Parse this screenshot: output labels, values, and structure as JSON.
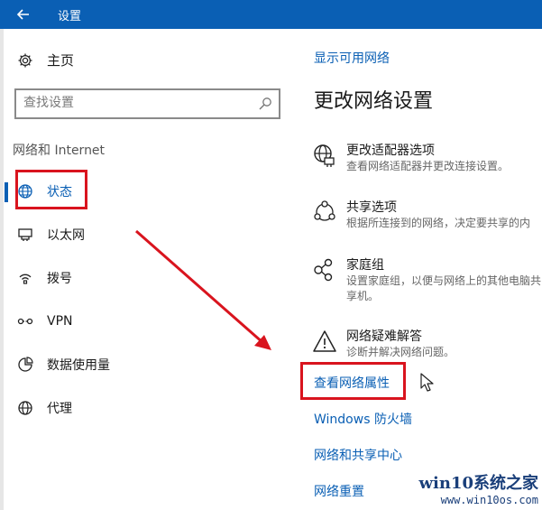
{
  "window": {
    "title": "设置"
  },
  "sidebar": {
    "home_label": "主页",
    "search_placeholder": "查找设置",
    "section_title": "网络和 Internet",
    "items": [
      {
        "label": "状态",
        "icon": "globe-icon"
      },
      {
        "label": "以太网",
        "icon": "ethernet-icon"
      },
      {
        "label": "拨号",
        "icon": "dialup-icon"
      },
      {
        "label": "VPN",
        "icon": "vpn-icon"
      },
      {
        "label": "数据使用量",
        "icon": "data-usage-icon"
      },
      {
        "label": "代理",
        "icon": "proxy-globe-icon"
      }
    ]
  },
  "main": {
    "show_networks_link": "显示可用网络",
    "heading": "更改网络设置",
    "options": [
      {
        "title": "更改适配器选项",
        "desc": "查看网络适配器并更改连接设置。",
        "icon": "adapter-icon"
      },
      {
        "title": "共享选项",
        "desc": "根据所连接到的网络，决定要共享的内",
        "icon": "sharing-icon"
      },
      {
        "title": "家庭组",
        "desc": "设置家庭组，以便与网络上的其他电脑共享机。",
        "icon": "homegroup-icon"
      },
      {
        "title": "网络疑难解答",
        "desc": "诊断并解决网络问题。",
        "icon": "warning-icon"
      }
    ],
    "links": {
      "view_properties": "查看网络属性",
      "firewall": "Windows 防火墙",
      "sharing_center": "网络和共享中心",
      "reset": "网络重置"
    }
  },
  "watermark": {
    "brand": "win10系统之家",
    "url": "www.win10os.com"
  },
  "colors": {
    "accent": "#0a5fb4",
    "highlight": "#d9141e",
    "titlebar": "#0a5fb4"
  }
}
